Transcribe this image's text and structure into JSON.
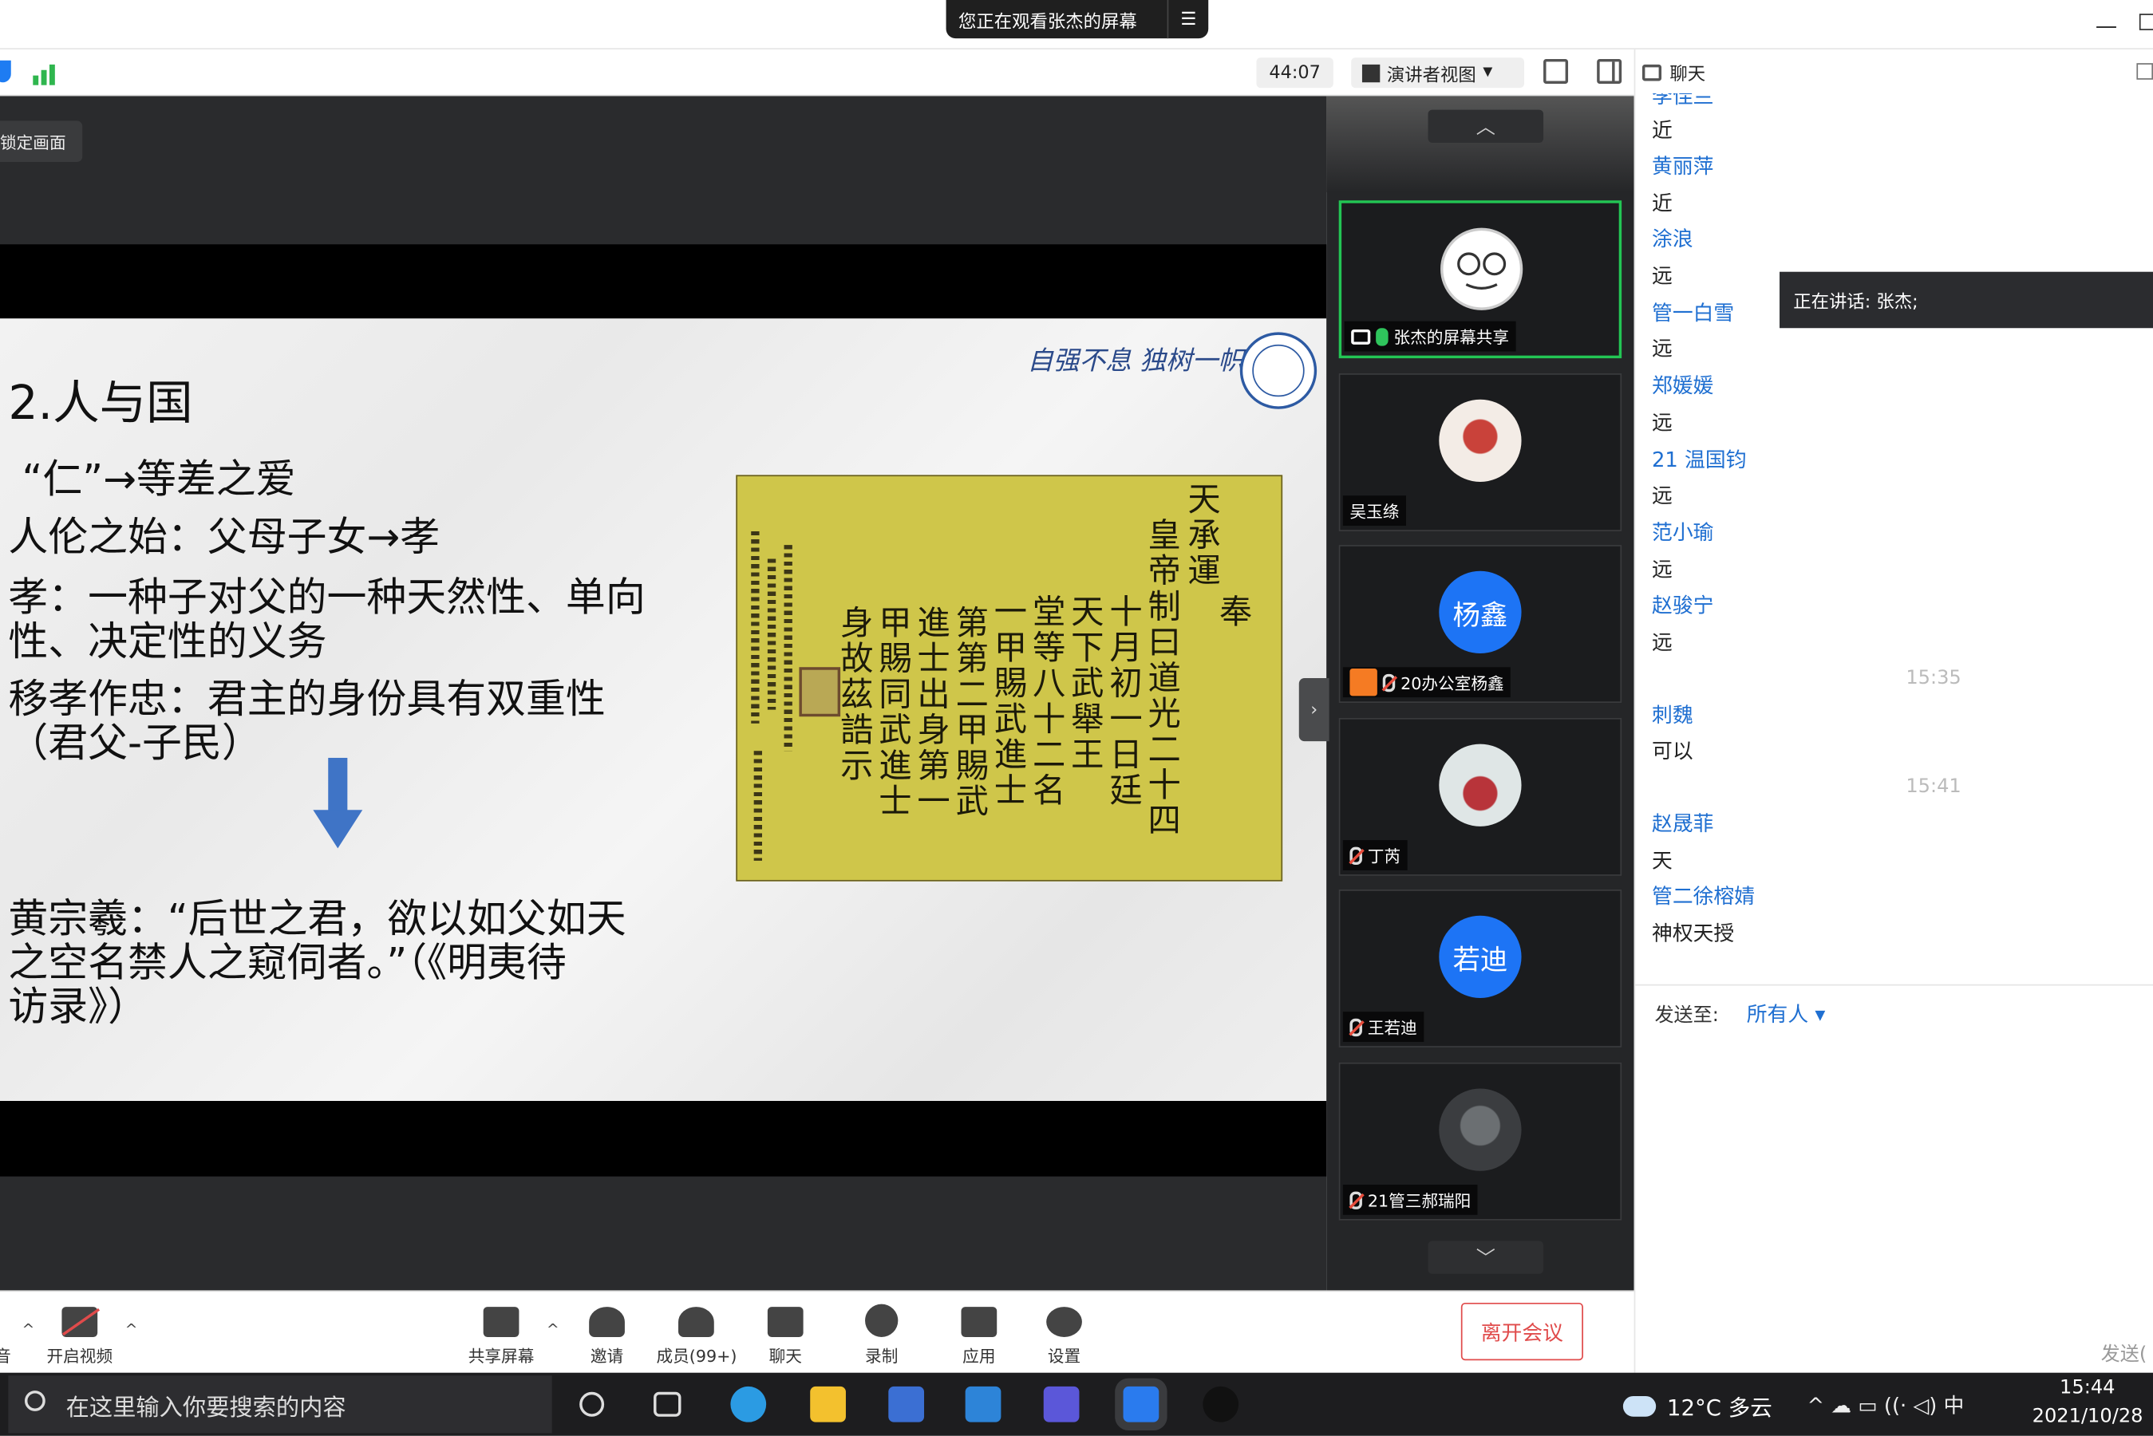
{
  "top_bar": {
    "share_notice": "您正在观看张杰的屏幕",
    "menu_icon": "menu-icon"
  },
  "toolbar": {
    "timer": "44:07",
    "view_label": "演讲者视图",
    "chat_title": "聊天"
  },
  "main": {
    "lock_label": "锁定画面"
  },
  "slide": {
    "title": "2.人与国",
    "motto": "自强不息 独树一帜",
    "lines": [
      "“仁”→等差之爱",
      "人伦之始：父母子女→孝",
      "孝：一种子对父的一种天然性、单向",
      "性、决定性的义务",
      "移孝作忠：君主的身份具有双重性",
      "（君父-子民）",
      "黄宗羲：“后世之君，欲以如父如天",
      "之空名禁人之窥伺者。”（《明夷待",
      "访录》）"
    ],
    "decree_columns": [
      "天承運",
      "皇帝制曰道光二十四",
      "十月初一日廷",
      "天下武舉王",
      "堂等八十二名",
      "一甲賜武進士",
      "第第二甲賜武",
      "進士出身第一",
      "甲賜同武進士",
      "身故茲誥示",
      "奉"
    ]
  },
  "gallery": {
    "tiles": [
      {
        "name": "张杰的屏幕共享",
        "avatar_text": "",
        "mic": "on",
        "active": true
      },
      {
        "name": "吴玉绦",
        "avatar_text": "",
        "mic": "none",
        "active": false
      },
      {
        "name": "20办公室杨鑫",
        "avatar_text": "杨鑫",
        "mic": "off",
        "active": false
      },
      {
        "name": "丁芮",
        "avatar_text": "",
        "mic": "off",
        "active": false
      },
      {
        "name": "王若迪",
        "avatar_text": "若迪",
        "mic": "off",
        "active": false
      },
      {
        "name": "21管三郝瑞阳",
        "avatar_text": "",
        "mic": "off",
        "active": false
      }
    ]
  },
  "bottom_bar": {
    "audio_label": "音",
    "video": "开启视频",
    "share": "共享屏幕",
    "invite": "邀请",
    "members": "成员(99+)",
    "chat": "聊天",
    "record": "录制",
    "apps": "应用",
    "settings": "设置",
    "leave": "离开会议"
  },
  "chat": {
    "messages": [
      {
        "type": "name",
        "text": "李佳兰"
      },
      {
        "type": "msg",
        "text": "近"
      },
      {
        "type": "name",
        "text": "黄丽萍"
      },
      {
        "type": "msg",
        "text": "近"
      },
      {
        "type": "name",
        "text": "涂浪"
      },
      {
        "type": "msg",
        "text": "远"
      },
      {
        "type": "name",
        "text": "管一白雪"
      },
      {
        "type": "msg",
        "text": "远"
      },
      {
        "type": "name",
        "text": "郑媛媛"
      },
      {
        "type": "msg",
        "text": "远"
      },
      {
        "type": "name",
        "text": "21 温国钧"
      },
      {
        "type": "msg",
        "text": "远"
      },
      {
        "type": "name",
        "text": "范小瑜"
      },
      {
        "type": "msg",
        "text": "远"
      },
      {
        "type": "name",
        "text": "赵骏宁"
      },
      {
        "type": "msg",
        "text": "远"
      },
      {
        "type": "time",
        "text": "15:35"
      },
      {
        "type": "name",
        "text": "刺魏"
      },
      {
        "type": "msg",
        "text": "可以"
      },
      {
        "type": "time",
        "text": "15:41"
      },
      {
        "type": "name",
        "text": "赵晟菲"
      },
      {
        "type": "msg",
        "text": "天"
      },
      {
        "type": "name",
        "text": "管二徐榕婧"
      },
      {
        "type": "msg",
        "text": "神权天授"
      }
    ],
    "speaking": "正在讲话: 张杰;",
    "send_to_label": "发送至:",
    "send_to_value": "所有人 ▾",
    "send_button": "发送("
  },
  "taskbar": {
    "search_placeholder": "在这里输入你要搜索的内容",
    "weather": "12°C  多云",
    "tray_text": "^   ☁   ▭   ((·   ◁)   中",
    "time": "15:44",
    "date": "2021/10/28"
  },
  "colors": {
    "accent": "#1d74f5",
    "active_speaker": "#23c554",
    "leave": "#e04b4b",
    "chat_name": "#1f6fd1"
  }
}
